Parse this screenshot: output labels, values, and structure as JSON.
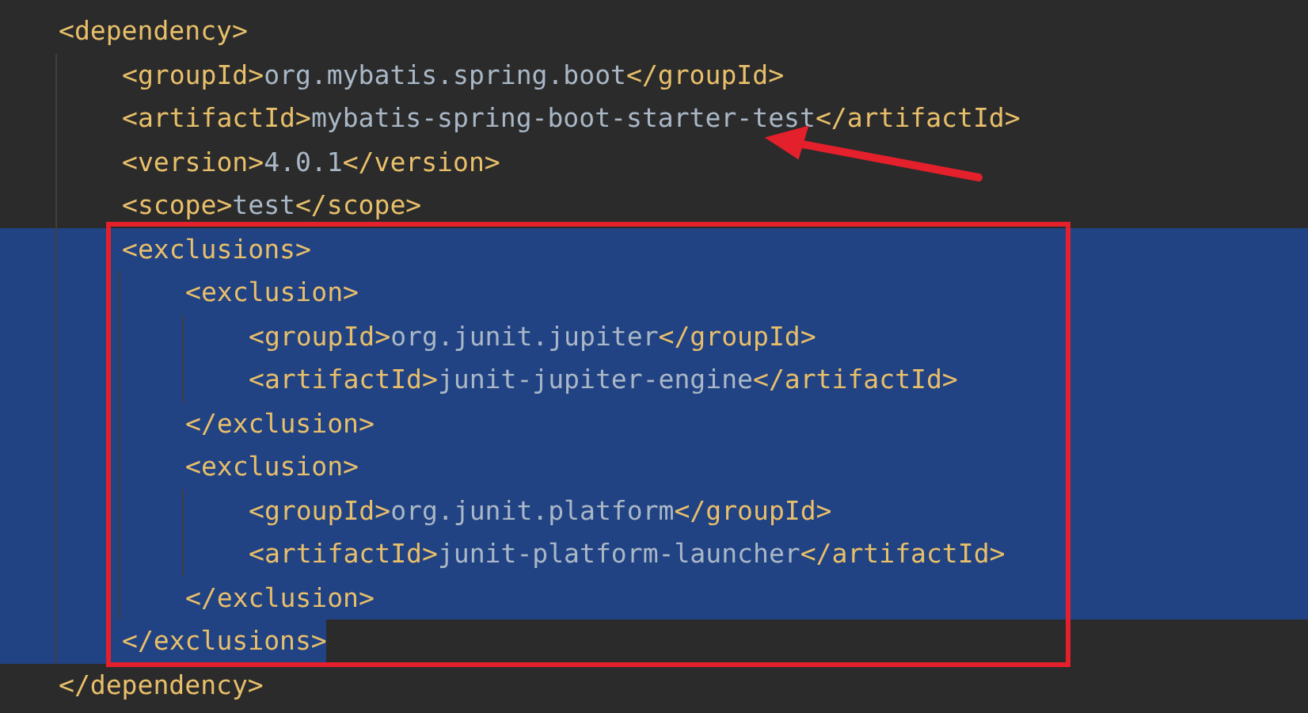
{
  "editor": {
    "nodes": [
      {
        "kind": "element",
        "open": {
          "selected": false,
          "segments": [
            {
              "kind": "tag",
              "text": "<dependency>"
            }
          ]
        },
        "children": [
          {
            "kind": "leaf",
            "line": {
              "selected": false,
              "segments": [
                {
                  "kind": "tag",
                  "text": "<groupId>"
                },
                {
                  "kind": "value",
                  "text": "org.mybatis.spring.boot"
                },
                {
                  "kind": "tag",
                  "text": "</groupId>"
                }
              ]
            }
          },
          {
            "kind": "leaf",
            "line": {
              "selected": false,
              "segments": [
                {
                  "kind": "tag",
                  "text": "<artifactId>"
                },
                {
                  "kind": "value",
                  "text": "mybatis-spring-boot-starter-test"
                },
                {
                  "kind": "tag",
                  "text": "</artifactId>"
                }
              ]
            }
          },
          {
            "kind": "leaf",
            "line": {
              "selected": false,
              "segments": [
                {
                  "kind": "tag",
                  "text": "<version>"
                },
                {
                  "kind": "value",
                  "text": "4.0.1"
                },
                {
                  "kind": "tag",
                  "text": "</version>"
                }
              ]
            }
          },
          {
            "kind": "leaf",
            "line": {
              "selected": false,
              "segments": [
                {
                  "kind": "tag",
                  "text": "<scope>"
                },
                {
                  "kind": "value",
                  "text": "test"
                },
                {
                  "kind": "tag",
                  "text": "</scope>"
                }
              ]
            }
          },
          {
            "kind": "element",
            "open": {
              "selected": true,
              "full_width": true,
              "segments": [
                {
                  "kind": "tag",
                  "text": "<exclusions>"
                }
              ]
            },
            "children": [
              {
                "kind": "element",
                "open": {
                  "selected": true,
                  "full_width": true,
                  "segments": [
                    {
                      "kind": "tag",
                      "text": "<exclusion>"
                    }
                  ]
                },
                "children": [
                  {
                    "kind": "leaf",
                    "line": {
                      "selected": true,
                      "full_width": true,
                      "segments": [
                        {
                          "kind": "tag",
                          "text": "<groupId>"
                        },
                        {
                          "kind": "value",
                          "text": "org.junit.jupiter"
                        },
                        {
                          "kind": "tag",
                          "text": "</groupId>"
                        }
                      ]
                    }
                  },
                  {
                    "kind": "leaf",
                    "line": {
                      "selected": true,
                      "full_width": true,
                      "segments": [
                        {
                          "kind": "tag",
                          "text": "<artifactId>"
                        },
                        {
                          "kind": "value",
                          "text": "junit-jupiter-engine"
                        },
                        {
                          "kind": "tag",
                          "text": "</artifactId>"
                        }
                      ]
                    }
                  }
                ],
                "close": {
                  "selected": true,
                  "full_width": true,
                  "segments": [
                    {
                      "kind": "tag",
                      "text": "</exclusion>"
                    }
                  ]
                }
              },
              {
                "kind": "element",
                "open": {
                  "selected": true,
                  "full_width": true,
                  "segments": [
                    {
                      "kind": "tag",
                      "text": "<exclusion>"
                    }
                  ]
                },
                "children": [
                  {
                    "kind": "leaf",
                    "line": {
                      "selected": true,
                      "full_width": true,
                      "segments": [
                        {
                          "kind": "tag",
                          "text": "<groupId>"
                        },
                        {
                          "kind": "value",
                          "text": "org.junit.platform"
                        },
                        {
                          "kind": "tag",
                          "text": "</groupId>"
                        }
                      ]
                    }
                  },
                  {
                    "kind": "leaf",
                    "line": {
                      "selected": true,
                      "full_width": true,
                      "segments": [
                        {
                          "kind": "tag",
                          "text": "<artifactId>"
                        },
                        {
                          "kind": "value",
                          "text": "junit-platform-launcher"
                        },
                        {
                          "kind": "tag",
                          "text": "</artifactId>"
                        }
                      ]
                    }
                  }
                ],
                "close": {
                  "selected": true,
                  "full_width": true,
                  "segments": [
                    {
                      "kind": "tag",
                      "text": "</exclusion>"
                    }
                  ]
                }
              }
            ],
            "close": {
              "selected": true,
              "full_width": false,
              "segments": [
                {
                  "kind": "tag",
                  "text": "</exclusions>"
                }
              ]
            }
          }
        ],
        "close": {
          "selected": false,
          "segments": [
            {
              "kind": "tag",
              "text": "</dependency>"
            }
          ]
        }
      }
    ]
  }
}
